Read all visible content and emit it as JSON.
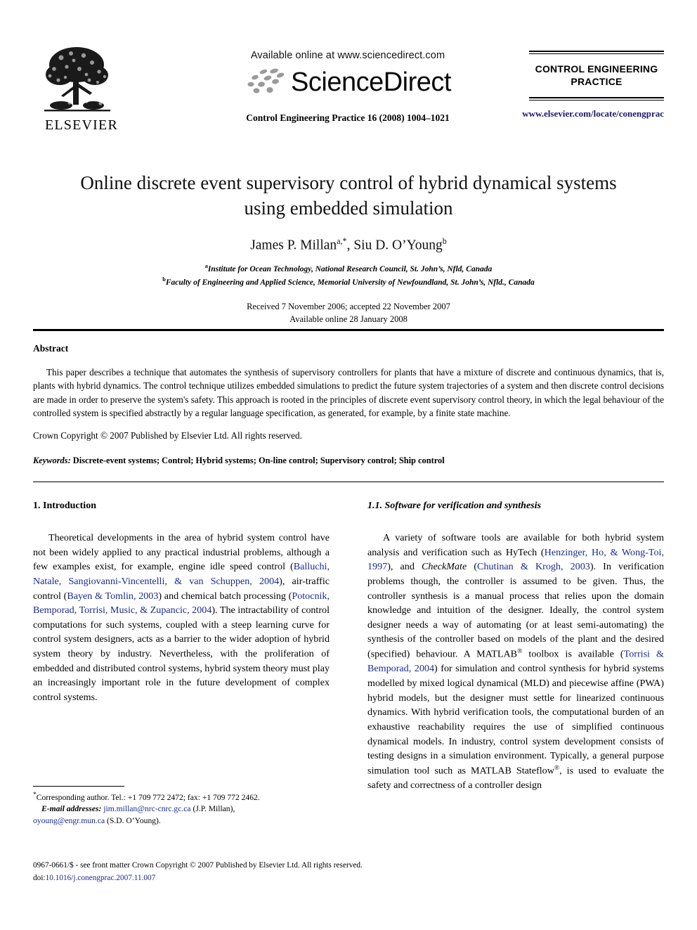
{
  "masthead": {
    "publisher_name": "ELSEVIER",
    "publisher_logo_icon": "elsevier-tree-logo",
    "available_online": "Available online at www.sciencedirect.com",
    "sciencedirect_wordmark": "ScienceDirect",
    "sciencedirect_logo_icon": "sciencedirect-swoosh-icon",
    "journal_citation": "Control Engineering Practice 16 (2008) 1004–1021",
    "journal_badge_title": "CONTROL ENGINEERING PRACTICE",
    "journal_url": "www.elsevier.com/locate/conengprac"
  },
  "article": {
    "title": "Online discrete event supervisory control of hybrid dynamical systems using embedded simulation",
    "authors": "James P. Millan",
    "author_sup_1": "a,*",
    "authors_2": ", Siu D. O’Young",
    "author_sup_2": "b",
    "affiliation_a_marker": "a",
    "affiliation_a": "Institute for Ocean Technology, National Research Council, St. John’s, Nfld, Canada",
    "affiliation_b_marker": "b",
    "affiliation_b": "Faculty of Engineering and Applied Science, Memorial University of Newfoundland, St. John’s, Nfld., Canada",
    "received_line": "Received 7 November 2006; accepted 22 November 2007",
    "online_line": "Available online 28 January 2008"
  },
  "abstract": {
    "heading": "Abstract",
    "body": "This paper describes a technique that automates the synthesis of supervisory controllers for plants that have a mixture of discrete and continuous dynamics, that is, plants with hybrid dynamics. The control technique utilizes embedded simulations to predict the future system trajectories of a system and then discrete control decisions are made in order to preserve the system's safety. This approach is rooted in the principles of discrete event supervisory control theory, in which the legal behaviour of the controlled system is specified abstractly by a regular language specification, as generated, for example, by a finite state machine.",
    "copyright": "Crown Copyright © 2007 Published by Elsevier Ltd. All rights reserved."
  },
  "keywords": {
    "label": "Keywords:",
    "text": " Discrete-event systems; Control; Hybrid systems; On-line control; Supervisory control; Ship control"
  },
  "left_column": {
    "section_heading": "1.  Introduction",
    "paragraph_parts": [
      {
        "type": "text",
        "text": "Theoretical developments in the area of hybrid system control have not been widely applied to any practical industrial problems, although a few examples exist, for example, engine idle speed control ("
      },
      {
        "type": "cite",
        "text": "Balluchi, Natale, Sangiovanni-Vincentelli, & van Schuppen, 2004"
      },
      {
        "type": "text",
        "text": "), air-traffic control ("
      },
      {
        "type": "cite",
        "text": "Bayen & Tomlin, 2003"
      },
      {
        "type": "text",
        "text": ") and chemical batch processing ("
      },
      {
        "type": "cite",
        "text": "Potocnik, Bemporad, Torrisi, Music, & Zupancic, 2004"
      },
      {
        "type": "text",
        "text": "). The intractability of control computations for such systems, coupled with a steep learning curve for control system designers, acts as a barrier to the wider adoption of hybrid system theory by industry. Nevertheless, with the proliferation of embedded and distributed control systems, hybrid system theory must play an increasingly important role in the future development of complex control systems."
      }
    ]
  },
  "right_column": {
    "section_heading": "1.1.  Software for verification and synthesis",
    "paragraph_parts": [
      {
        "type": "text",
        "text": "A variety of software tools are available for both hybrid system analysis and verification such as HyTech ("
      },
      {
        "type": "cite",
        "text": "Henzinger, Ho, & Wong-Toi, 1997"
      },
      {
        "type": "text",
        "text": "), and "
      },
      {
        "type": "italic",
        "text": "CheckMate"
      },
      {
        "type": "text",
        "text": " ("
      },
      {
        "type": "cite",
        "text": "Chutinan & Krogh, 2003"
      },
      {
        "type": "text",
        "text": "). In verification problems though, the controller is assumed to be given. Thus, the controller synthesis is a manual process that relies upon the domain knowledge and intuition of the designer. Ideally, the control system designer needs a way of automating (or at least semi-automating) the synthesis of the controller based on models of the plant and the desired (specified) behaviour. A MATLAB"
      },
      {
        "type": "sup",
        "text": "®"
      },
      {
        "type": "text",
        "text": " toolbox is available ("
      },
      {
        "type": "cite",
        "text": "Torrisi & Bemporad, 2004"
      },
      {
        "type": "text",
        "text": ") for simulation and control synthesis for hybrid systems modelled by mixed logical dynamical (MLD) and piecewise affine (PWA) hybrid models, but the designer must settle for linearized continuous dynamics. With hybrid verification tools, the computational burden of an exhaustive reachability requires the use of simplified continuous dynamical models. In industry, control system development consists of testing designs in a simulation environment. Typically, a general purpose simulation tool such as MATLAB Stateflow"
      },
      {
        "type": "sup",
        "text": "®"
      },
      {
        "type": "text",
        "text": ", is used to evaluate the safety and correctness of a controller design"
      }
    ]
  },
  "footnote": {
    "corresponding_marker": "*",
    "corresponding_text": "Corresponding author. Tel.: +1 709 772 2472; fax: +1 709 772 2462.",
    "email_label": "E-mail addresses:",
    "email_1": "jim.millan@nrc-cnrc.gc.ca",
    "email_1_owner": " (J.P. Millan),",
    "email_2": "oyoung@engr.mun.ca",
    "email_2_owner": " (S.D. O’Young)."
  },
  "page_footer": {
    "issn_line": "0967-0661/$ - see front matter Crown Copyright © 2007 Published by Elsevier Ltd. All rights reserved.",
    "doi_label": "doi:",
    "doi_value": "10.1016/j.conengprac.2007.11.007"
  },
  "colors": {
    "link": "#1a2a8c",
    "journal_url": "#1a1a6e",
    "text": "#000000"
  }
}
